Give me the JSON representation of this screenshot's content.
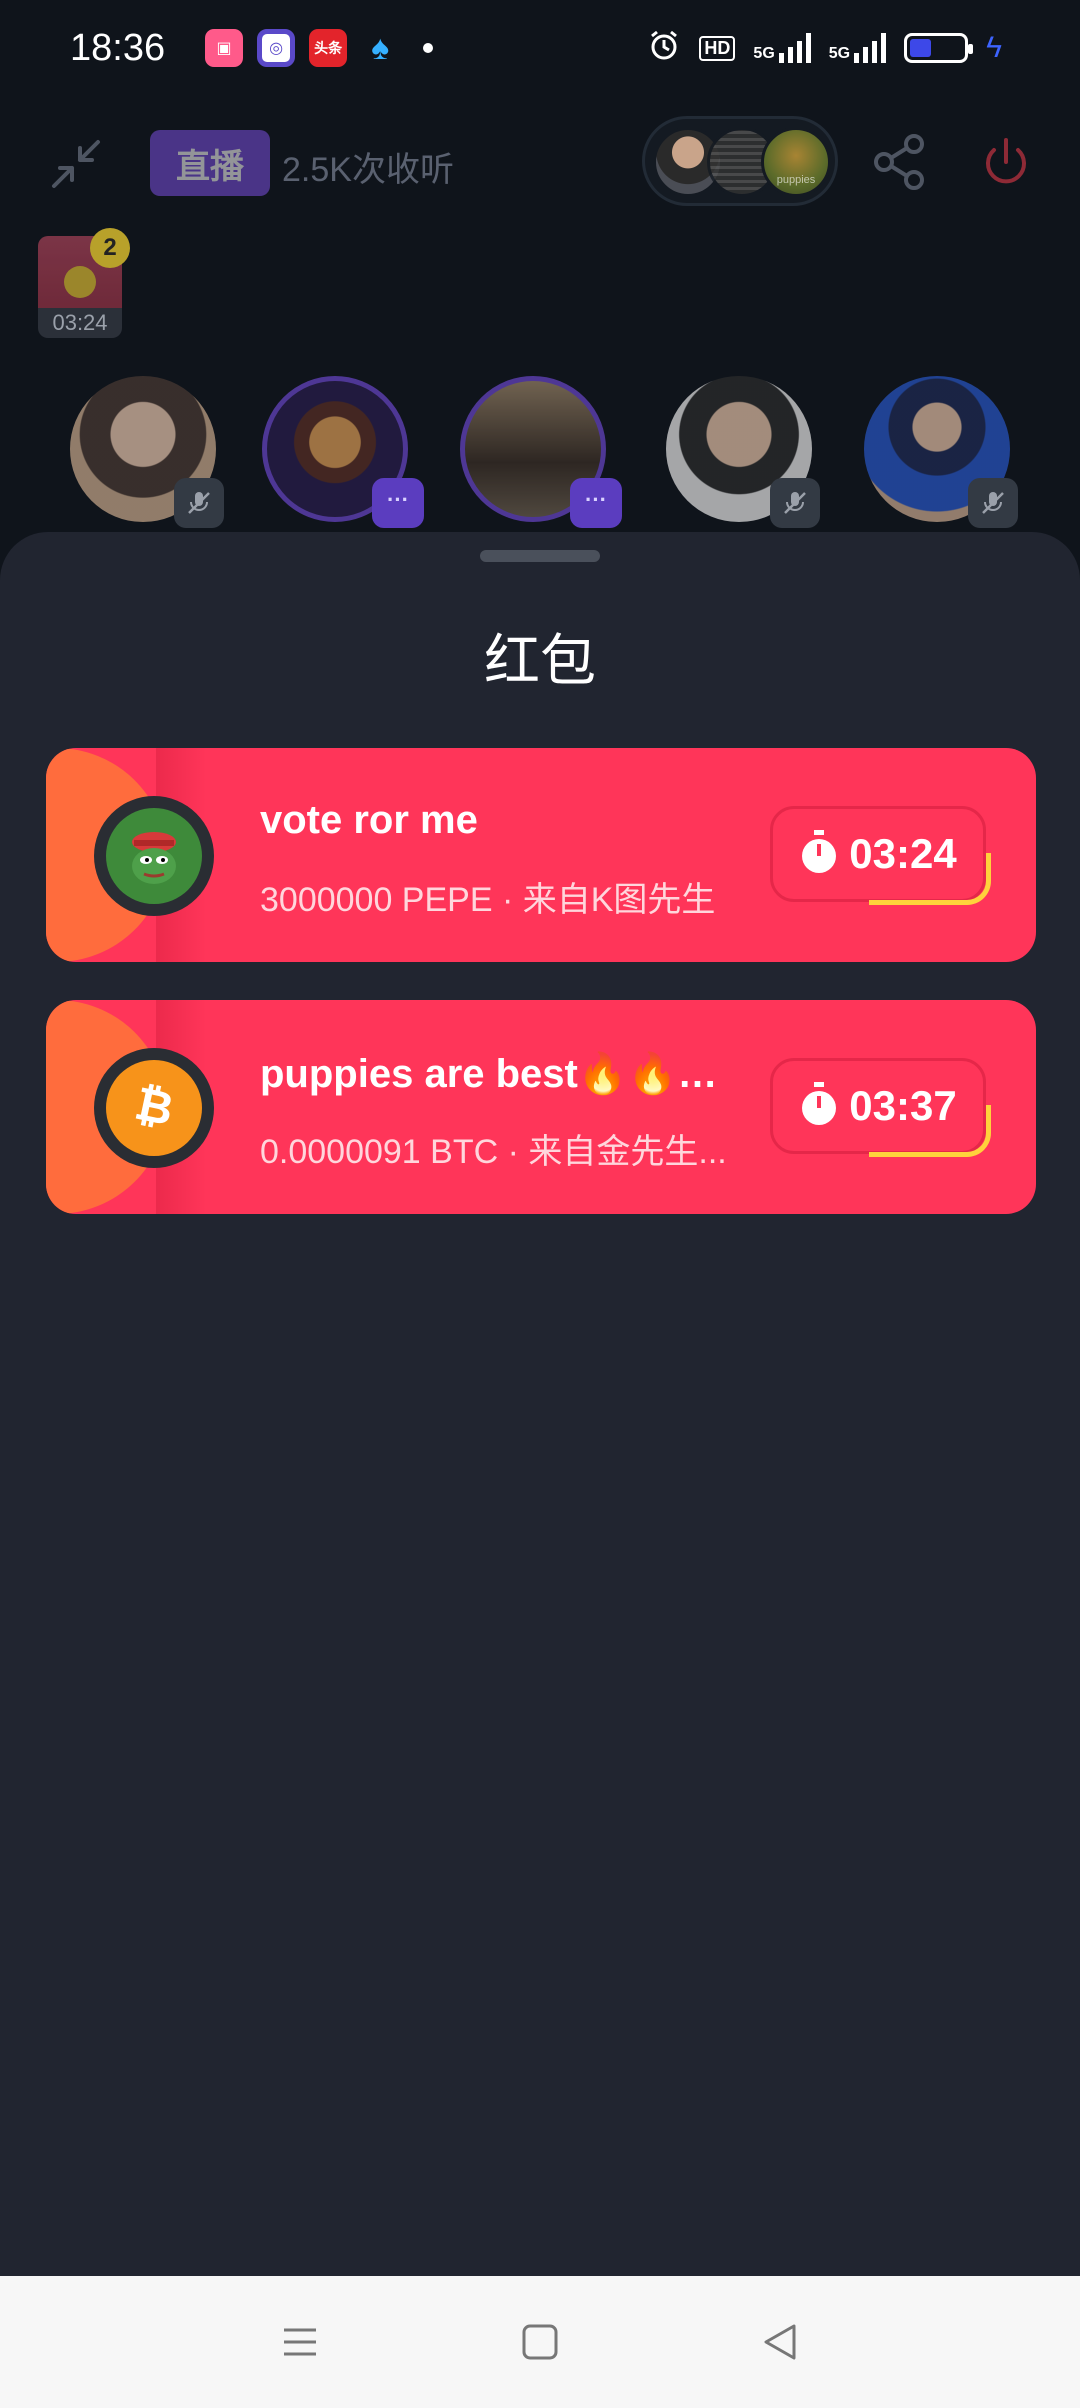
{
  "status_bar": {
    "time": "18:36",
    "notification_icons": [
      "bilibili-icon",
      "browser-icon",
      "toutiao-icon",
      "qq-icon"
    ],
    "toutiao_label": "头条",
    "hd_label": "HD",
    "net1": "5G",
    "net2": "5G",
    "battery_level": 0.4
  },
  "header": {
    "live_label": "直播",
    "listen_count": "2.5K次收听",
    "stack_avatar_text": "puppies"
  },
  "mini_envelope": {
    "badge_count": "2",
    "time": "03:24"
  },
  "speakers": [
    {
      "name": "speaker-1",
      "muted": true
    },
    {
      "name": "speaker-2",
      "muted": false
    },
    {
      "name": "speaker-3",
      "muted": false
    },
    {
      "name": "speaker-4",
      "muted": true
    },
    {
      "name": "speaker-5",
      "muted": true
    }
  ],
  "sheet": {
    "title": "红包",
    "cards": [
      {
        "title": "vote ror me",
        "subtitle": "3000000 PEPE · 来自K图先生",
        "timer": "03:24",
        "coin": "pepe"
      },
      {
        "title": "puppies are best🔥🔥🔥...",
        "subtitle": "0.0000091 BTC · 来自金先生...",
        "timer": "03:37",
        "coin": "btc"
      }
    ]
  },
  "colors": {
    "card_red": "#ff3559",
    "card_orange": "#ff6c3d",
    "sheet_bg": "#212530",
    "live_purple": "#7b4fe0",
    "timer_arc": "#ffd23c"
  }
}
